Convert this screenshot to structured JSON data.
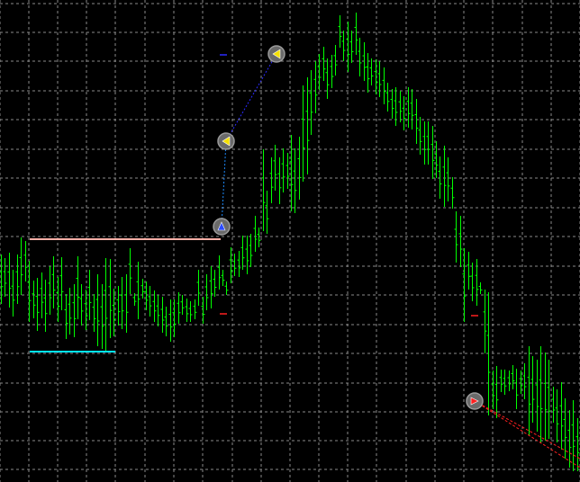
{
  "colors": {
    "background": "#000000",
    "grid": "#8a8a8a",
    "bars": "#00ff00",
    "resistance_line": "#ffb0a8",
    "support_line": "#00e5ff",
    "trade_line_buy": "#2b2bff",
    "trade_line_sell": "#ff2020",
    "marker_ring": "#9a9a9a"
  },
  "chart_data": {
    "type": "bar",
    "style": "hl-bars",
    "grid": true,
    "y_axis_visible": false,
    "x_axis_visible": false,
    "price_range": [
      0,
      536
    ],
    "bars": [
      [
        283,
        338
      ],
      [
        287,
        330
      ],
      [
        281,
        342
      ],
      [
        300,
        352
      ],
      [
        283,
        338
      ],
      [
        264,
        328
      ],
      [
        268,
        313
      ],
      [
        290,
        358
      ],
      [
        312,
        354
      ],
      [
        309,
        368
      ],
      [
        303,
        354
      ],
      [
        311,
        369
      ],
      [
        296,
        350
      ],
      [
        285,
        343
      ],
      [
        308,
        358
      ],
      [
        286,
        345
      ],
      [
        327,
        377
      ],
      [
        320,
        372
      ],
      [
        316,
        375
      ],
      [
        285,
        355
      ],
      [
        316,
        362
      ],
      [
        322,
        367
      ],
      [
        300,
        356
      ],
      [
        327,
        369
      ],
      [
        305,
        385
      ],
      [
        316,
        388
      ],
      [
        287,
        390
      ],
      [
        288,
        376
      ],
      [
        321,
        374
      ],
      [
        318,
        362
      ],
      [
        308,
        366
      ],
      [
        305,
        370
      ],
      [
        276,
        327
      ],
      [
        326,
        340
      ],
      [
        291,
        355
      ],
      [
        310,
        332
      ],
      [
        313,
        345
      ],
      [
        318,
        352
      ],
      [
        323,
        358
      ],
      [
        328,
        363
      ],
      [
        330,
        370
      ],
      [
        341,
        374
      ],
      [
        333,
        380
      ],
      [
        333,
        375
      ],
      [
        325,
        360
      ],
      [
        328,
        350
      ],
      [
        332,
        358
      ],
      [
        335,
        358
      ],
      [
        333,
        355
      ],
      [
        300,
        340
      ],
      [
        330,
        360
      ],
      [
        305,
        345
      ],
      [
        296,
        343
      ],
      [
        300,
        330
      ],
      [
        284,
        322
      ],
      [
        300,
        318
      ],
      [
        313,
        328
      ],
      [
        275,
        315
      ],
      [
        282,
        307
      ],
      [
        279,
        308
      ],
      [
        262,
        300
      ],
      [
        262,
        305
      ],
      [
        260,
        297
      ],
      [
        240,
        280
      ],
      [
        253,
        275
      ],
      [
        166,
        257
      ],
      [
        212,
        260
      ],
      [
        175,
        226
      ],
      [
        161,
        212
      ],
      [
        175,
        227
      ],
      [
        165,
        214
      ],
      [
        170,
        210
      ],
      [
        150,
        235
      ],
      [
        165,
        237
      ],
      [
        152,
        222
      ],
      [
        95,
        202
      ],
      [
        86,
        194
      ],
      [
        78,
        150
      ],
      [
        68,
        126
      ],
      [
        60,
        100
      ],
      [
        52,
        90
      ],
      [
        65,
        110
      ],
      [
        61,
        98
      ],
      [
        50,
        84
      ],
      [
        17,
        53
      ],
      [
        34,
        68
      ],
      [
        24,
        80
      ],
      [
        34,
        70
      ],
      [
        14,
        61
      ],
      [
        42,
        85
      ],
      [
        47,
        90
      ],
      [
        59,
        103
      ],
      [
        65,
        95
      ],
      [
        66,
        105
      ],
      [
        68,
        108
      ],
      [
        75,
        116
      ],
      [
        92,
        124
      ],
      [
        99,
        132
      ],
      [
        97,
        140
      ],
      [
        101,
        136
      ],
      [
        107,
        145
      ],
      [
        97,
        142
      ],
      [
        99,
        144
      ],
      [
        110,
        160
      ],
      [
        130,
        172
      ],
      [
        135,
        183
      ],
      [
        135,
        183
      ],
      [
        140,
        199
      ],
      [
        157,
        198
      ],
      [
        174,
        221
      ],
      [
        162,
        230
      ],
      [
        175,
        224
      ],
      [
        197,
        232
      ],
      [
        235,
        292
      ],
      [
        240,
        297
      ],
      [
        276,
        358
      ],
      [
        280,
        322
      ],
      [
        292,
        335
      ],
      [
        288,
        340
      ],
      [
        314,
        327
      ],
      [
        322,
        393
      ],
      [
        325,
        462
      ],
      [
        412,
        455
      ],
      [
        407,
        465
      ],
      [
        411,
        436
      ],
      [
        411,
        439
      ],
      [
        412,
        435
      ],
      [
        406,
        433
      ],
      [
        410,
        455
      ],
      [
        412,
        438
      ],
      [
        404,
        444
      ],
      [
        385,
        484
      ],
      [
        396,
        470
      ],
      [
        400,
        480
      ],
      [
        385,
        492
      ],
      [
        392,
        490
      ],
      [
        400,
        488
      ],
      [
        430,
        470
      ],
      [
        433,
        492
      ],
      [
        425,
        500
      ],
      [
        443,
        510
      ],
      [
        456,
        520
      ],
      [
        445,
        524
      ],
      [
        465,
        524
      ]
    ],
    "horizontal_lines": [
      {
        "name": "resistance",
        "price": 266
      },
      {
        "name": "support",
        "price": 391
      }
    ],
    "order_lines": [
      {
        "name": "buy-1",
        "type": "buy"
      },
      {
        "name": "buy-2",
        "type": "buy"
      },
      {
        "name": "sell-1",
        "type": "sell"
      }
    ],
    "trade_markers": [
      {
        "name": "buy-entry",
        "kind": "buy"
      },
      {
        "name": "sell-exit-1",
        "kind": "sell"
      },
      {
        "name": "sell-exit-2",
        "kind": "sell"
      },
      {
        "name": "sell-entry",
        "kind": "sell"
      }
    ]
  }
}
